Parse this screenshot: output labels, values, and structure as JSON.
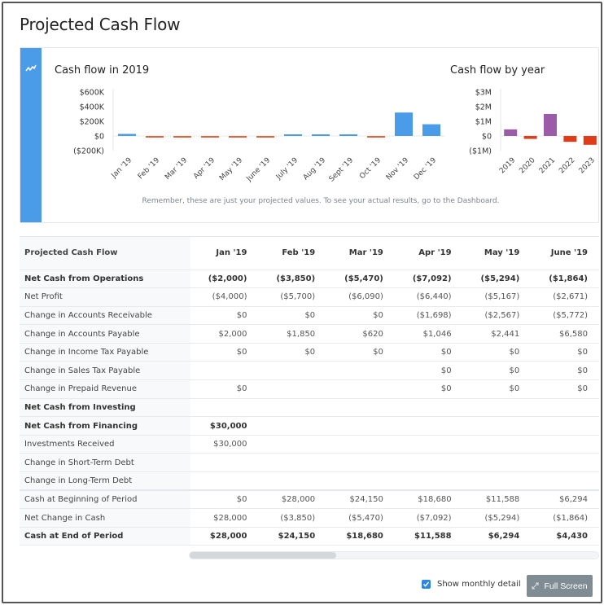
{
  "page": {
    "title": "Projected Cash Flow"
  },
  "chart_card": {
    "icon": "trend-line-icon",
    "note": "Remember, these are just your projected values. To see your actual results, go to the Dashboard."
  },
  "chart_data": [
    {
      "type": "bar",
      "title": "Cash flow in 2019",
      "xlabel": "",
      "ylabel": "",
      "categories": [
        "Jan '19",
        "Feb '19",
        "Mar '19",
        "Apr '19",
        "May '19",
        "June '19",
        "July '19",
        "Aug '19",
        "Sept '19",
        "Oct '19",
        "Nov '19",
        "Dec '19"
      ],
      "values": [
        28000,
        -3850,
        -5470,
        -7092,
        -5294,
        -1864,
        0,
        0,
        2000,
        -8000,
        320000,
        160000
      ],
      "ylim": [
        -200000,
        600000
      ],
      "yticks": [
        600000,
        400000,
        200000,
        0,
        -200000
      ],
      "ytick_labels": [
        "$600K",
        "$400K",
        "$200K",
        "$0",
        "($200K)"
      ],
      "colors": {
        "positive": "#4a9be8",
        "negative": "#e0623e"
      },
      "grid": false,
      "legend": "none"
    },
    {
      "type": "bar",
      "title": "Cash flow by year",
      "xlabel": "",
      "ylabel": "",
      "categories": [
        "2019",
        "2020",
        "2021",
        "2022",
        "2023"
      ],
      "values": [
        450000,
        -200000,
        1500000,
        -400000,
        -600000
      ],
      "ylim": [
        -1000000,
        3000000
      ],
      "yticks": [
        3000000,
        2000000,
        1000000,
        0,
        -1000000
      ],
      "ytick_labels": [
        "$3M",
        "$2M",
        "$1M",
        "$0",
        "($1M)"
      ],
      "colors": {
        "positive": "#9b5ba8",
        "negative": "#e03c1a"
      },
      "grid": false,
      "legend": "none"
    }
  ],
  "table": {
    "header": [
      "Projected Cash Flow",
      "Jan '19",
      "Feb '19",
      "Mar '19",
      "Apr '19",
      "May '19",
      "June '19"
    ],
    "rows": [
      {
        "label": "Net Cash from Operations",
        "bold": true,
        "values": [
          "($2,000)",
          "($3,850)",
          "($5,470)",
          "($7,092)",
          "($5,294)",
          "($1,864)"
        ]
      },
      {
        "label": "Net Profit",
        "values": [
          "($4,000)",
          "($5,700)",
          "($6,090)",
          "($6,440)",
          "($5,167)",
          "($2,671)"
        ]
      },
      {
        "label": "Change in Accounts Receivable",
        "values": [
          "$0",
          "$0",
          "$0",
          "($1,698)",
          "($2,567)",
          "($5,772)"
        ]
      },
      {
        "label": "Change in Accounts Payable",
        "values": [
          "$2,000",
          "$1,850",
          "$620",
          "$1,046",
          "$2,441",
          "$6,580"
        ]
      },
      {
        "label": "Change in Income Tax Payable",
        "values": [
          "$0",
          "$0",
          "$0",
          "$0",
          "$0",
          "$0"
        ]
      },
      {
        "label": "Change in Sales Tax Payable",
        "values": [
          "",
          "",
          "",
          "$0",
          "$0",
          "$0"
        ]
      },
      {
        "label": "Change in Prepaid Revenue",
        "values": [
          "$0",
          "",
          "",
          "$0",
          "$0",
          "$0"
        ]
      },
      {
        "label": "Net Cash from Investing",
        "bold": true,
        "values": [
          "",
          "",
          "",
          "",
          "",
          ""
        ]
      },
      {
        "label": "Net Cash from Financing",
        "bold": true,
        "values": [
          "$30,000",
          "",
          "",
          "",
          "",
          ""
        ]
      },
      {
        "label": "Investments Received",
        "values": [
          "$30,000",
          "",
          "",
          "",
          "",
          ""
        ]
      },
      {
        "label": "Change in Short-Term Debt",
        "values": [
          "",
          "",
          "",
          "",
          "",
          ""
        ]
      },
      {
        "label": "Change in Long-Term Debt",
        "values": [
          "",
          "",
          "",
          "",
          "",
          ""
        ]
      },
      {
        "label": "Cash at Beginning of Period",
        "sep": true,
        "values": [
          "$0",
          "$28,000",
          "$24,150",
          "$18,680",
          "$11,588",
          "$6,294"
        ]
      },
      {
        "label": "Net Change in Cash",
        "values": [
          "$28,000",
          "($3,850)",
          "($5,470)",
          "($7,092)",
          "($5,294)",
          "($1,864)"
        ]
      },
      {
        "label": "Cash at End of Period",
        "bold": true,
        "values": [
          "$28,000",
          "$24,150",
          "$18,680",
          "$11,588",
          "$6,294",
          "$4,430"
        ]
      }
    ],
    "scroll_position": 0
  },
  "footer": {
    "show_monthly_label": "Show monthly detail",
    "show_monthly_checked": true,
    "fullscreen_label": "Full Screen",
    "fullscreen_icon": "expand-icon"
  }
}
